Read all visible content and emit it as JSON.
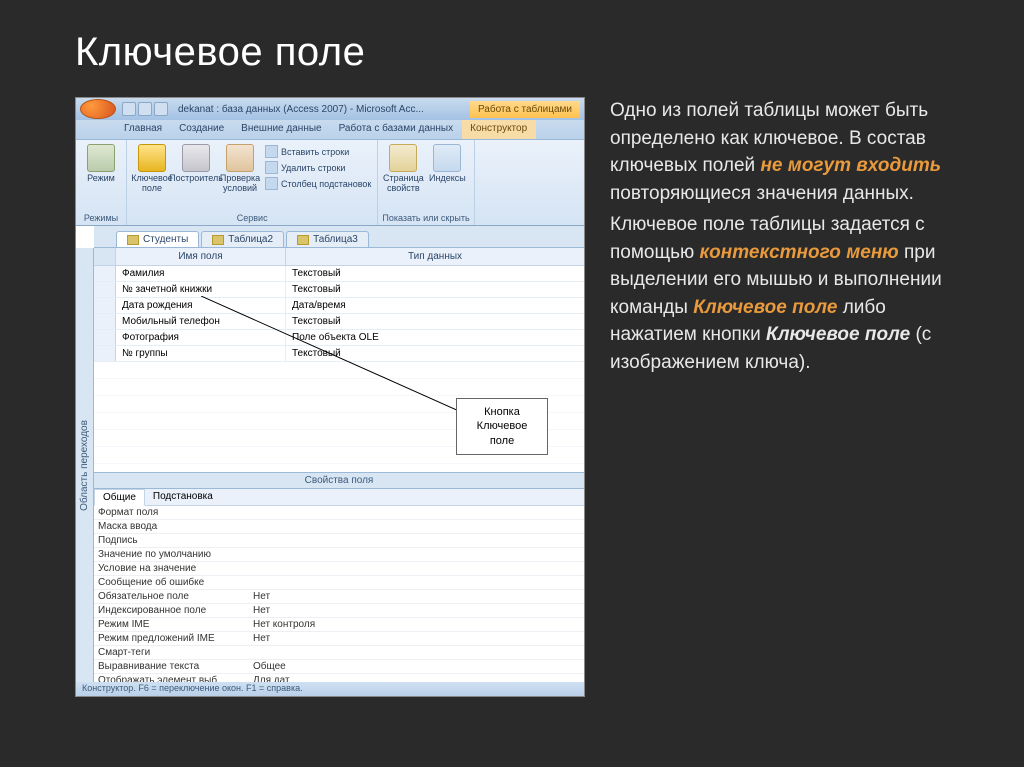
{
  "slide": {
    "title": "Ключевое поле"
  },
  "callout": {
    "line1": "Кнопка",
    "line2": "Ключевое",
    "line3": "поле"
  },
  "access": {
    "title": "dekanat : база данных (Access 2007) - Microsoft Acc...",
    "contextual_title": "Работа с таблицами",
    "tabs": {
      "home": "Главная",
      "create": "Создание",
      "external": "Внешние данные",
      "db_tools": "Работа с базами данных",
      "design": "Конструктор"
    },
    "ribbon": {
      "view": "Режим",
      "key": "Ключевое поле",
      "builder": "Построитель",
      "validate": "Проверка условий",
      "insert_rows": "Вставить строки",
      "delete_rows": "Удалить строки",
      "lookup_col": "Столбец подстановок",
      "prop_sheet": "Страница свойств",
      "indexes": "Индексы",
      "group_views": "Режимы",
      "group_tools": "Сервис",
      "group_showhide": "Показать или скрыть"
    },
    "nav_pane": "Область переходов",
    "doc_tabs": {
      "t1": "Студенты",
      "t2": "Таблица2",
      "t3": "Таблица3"
    },
    "design_grid": {
      "header_name": "Имя поля",
      "header_type": "Тип данных",
      "rows": [
        {
          "name": "Фамилия",
          "type": "Текстовый"
        },
        {
          "name": "№ зачетной книжки",
          "type": "Текстовый"
        },
        {
          "name": "Дата рождения",
          "type": "Дата/время"
        },
        {
          "name": "Мобильный телефон",
          "type": "Текстовый"
        },
        {
          "name": "Фотография",
          "type": "Поле объекта OLE"
        },
        {
          "name": "№ группы",
          "type": "Текстовый"
        }
      ]
    },
    "props": {
      "header": "Свойства поля",
      "tab_general": "Общие",
      "tab_lookup": "Подстановка",
      "rows": [
        {
          "label": "Формат поля",
          "value": ""
        },
        {
          "label": "Маска ввода",
          "value": ""
        },
        {
          "label": "Подпись",
          "value": ""
        },
        {
          "label": "Значение по умолчанию",
          "value": ""
        },
        {
          "label": "Условие на значение",
          "value": ""
        },
        {
          "label": "Сообщение об ошибке",
          "value": ""
        },
        {
          "label": "Обязательное поле",
          "value": "Нет"
        },
        {
          "label": "Индексированное поле",
          "value": "Нет"
        },
        {
          "label": "Режим IME",
          "value": "Нет контроля"
        },
        {
          "label": "Режим предложений IME",
          "value": "Нет"
        },
        {
          "label": "Смарт-теги",
          "value": ""
        },
        {
          "label": "Выравнивание текста",
          "value": "Общее"
        },
        {
          "label": "Отображать элемент выб",
          "value": "Для дат"
        }
      ]
    },
    "statusbar": "Конструктор.  F6 = переключение окон.  F1 = справка."
  },
  "text": {
    "p1a": "Одно из полей таблицы может быть определено как ключевое. В состав ключевых полей ",
    "p1b": "не могут входить",
    "p1c": " повторяющиеся значения данных.",
    "p2a": "Ключевое поле таблицы задается с помощью ",
    "p2b": "контекстного меню",
    "p2c": " при выделении его мышью и выполнении команды ",
    "p2d": "Ключевое поле",
    "p2e": " либо нажатием кнопки ",
    "p2f": "Ключевое поле",
    "p2g": " (с изображением ключа)."
  }
}
